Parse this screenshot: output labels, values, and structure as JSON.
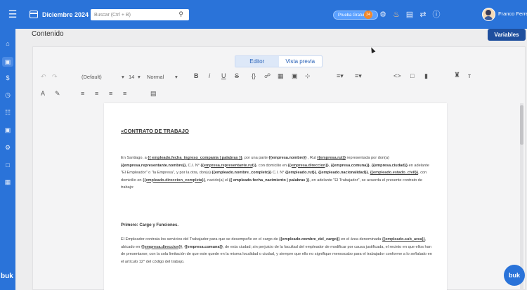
{
  "topbar": {
    "date_label": "Diciembre 2024",
    "search_placeholder": "Buscar (Ctrl + B)",
    "trial_label": "Prueba Gratuita",
    "user_name": "Franco Ferrer",
    "brand_color": "#2a73d9"
  },
  "sidebar": {
    "logo": "buk",
    "items": [
      "home-icon",
      "contracts-icon",
      "payments-icon",
      "clock-icon",
      "org-chart-icon",
      "briefcase-icon",
      "settings-icon",
      "folder-icon",
      "calculator-icon"
    ]
  },
  "page": {
    "title": "Contenido",
    "variables_label": "Variables"
  },
  "editor": {
    "tabs": [
      "Editor",
      "Vista previa"
    ],
    "active_tab": "Editor",
    "font_family": "(Default)",
    "font_size": "14",
    "block_style": "Normal"
  },
  "document": {
    "title": "«CONTRATO DE TRABAJO",
    "section_1_heading": "Primero: Cargo y Funciones.",
    "p1": {
      "t1": "En Santiago, a ",
      "v1": "{{ empleado.fecha_ingreso_compania | palabras }}",
      "t2": ", por una parte ",
      "v2": "{{empresa.nombre}}",
      "t3": " , Rut ",
      "v3": "{{empresa.rut}}",
      "t4": " representada por don(a) ",
      "v4": "{{empresa.representante.nombre}}",
      "t5": ", C.I. N° ",
      "v5": "{{empresa.representante.rut}}",
      "t6": ", con domicilio en ",
      "v6": "{{empresa.direccion}}",
      "t7": ", ",
      "v7": "{{empresa.comuna}}",
      "t8": ", ",
      "v8": "{{empresa.ciudad}}",
      "t9": " en adelante \"El Empleador\" o \"la Empresa\", y por la otra, don(a) ",
      "v9": "{{empleado.nombre_completo}}",
      "t10": " C.I. N° ",
      "v10": "{{empleado.rut}}",
      "t11": ", ",
      "v11": "{{empleado.nacionalidad}}",
      "t12": ", ",
      "v12": "{{empleado.estado_civil}}",
      "t13": ", con domicilio en ",
      "v13": "{{empleado.direccion_completa}}",
      "t14": ", nacido(a) el ",
      "v14": "{{ empleado.fecha_nacimiento | palabras }}",
      "t15": ", en adelante \"El Trabajador\", se acuerda el presente contrato de trabajo:"
    },
    "p2": {
      "t1": "El Empleador contrata los servicios del Trabajador para que se desempeñe en el cargo de ",
      "v1": "{{empleado.nombre_del_cargo}}",
      "t2": " en el área denominada ",
      "v2": "{{empleado.sub_area}}",
      "t3": ", ubicado en ",
      "v3": "{{empresa.direccion}}",
      "t4": ", ",
      "v4": "{{empresa.comuna}}",
      "t5": ", de esta ciudad; sin perjuicio de la facultad del empleador de modificar por causa justificada, el recinto en que ellos han de presentarse; con la sola limitación de que este quede en la misma localidad o ciudad, y siempre que ello no signifique menoscabo para el trabajador conforme a lo señalado en el artículo 12° del código del trabajo."
    }
  },
  "fab_label": "buk"
}
